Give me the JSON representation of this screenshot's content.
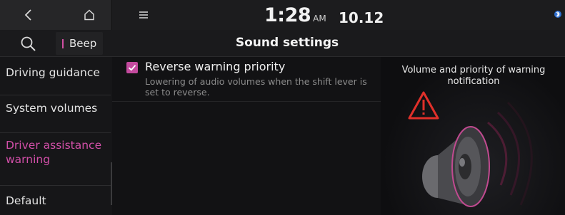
{
  "topbar": {
    "time": "1:28",
    "ampm": "AM",
    "date": "10.12"
  },
  "header": {
    "chip_label": "Beep",
    "title": "Sound settings"
  },
  "sidebar": {
    "items": [
      {
        "label": "Driving guidance",
        "active": false
      },
      {
        "label": "System volumes",
        "active": false
      },
      {
        "label": "Driver assistance warning",
        "active": true
      },
      {
        "label": "Default",
        "active": false
      }
    ]
  },
  "main": {
    "option": {
      "title": "Reverse warning priority",
      "description": "Lowering of audio volumes when the shift lever is set to reverse.",
      "checked": true
    }
  },
  "info": {
    "caption": "Volume and priority of warning notification"
  },
  "colors": {
    "accent": "#d24fa8",
    "background": "#121214"
  },
  "icons": [
    "back-icon",
    "home-icon",
    "menu-icon",
    "bluetooth-icon",
    "search-icon",
    "checkbox-check-icon",
    "warning-icon",
    "speaker-icon"
  ]
}
